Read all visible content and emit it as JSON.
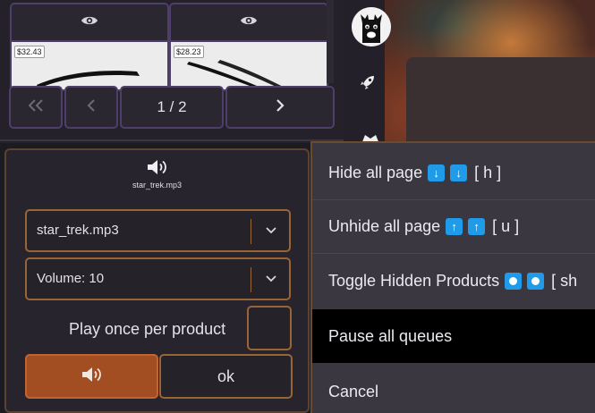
{
  "products": [
    {
      "price": "$32.43"
    },
    {
      "price": "$28.23"
    }
  ],
  "pager": {
    "page_label": "1 / 2"
  },
  "sound_modal": {
    "file_label": "star_trek.mp3",
    "sound_select_value": "star_trek.mp3",
    "volume_select_value": "Volume: 10",
    "play_once_label": "Play once per product",
    "ok_label": "ok"
  },
  "context_menu": {
    "items": [
      {
        "label": "Hide all page",
        "shortcut": "[ h ]"
      },
      {
        "label": "Unhide all page",
        "shortcut": "[ u ]"
      },
      {
        "label": "Toggle Hidden Products",
        "shortcut": "[ sh"
      },
      {
        "label": "Pause all queues"
      },
      {
        "label": "Cancel"
      }
    ]
  },
  "colors": {
    "accent_orange": "#a24d22",
    "badge_blue": "#1f9bea",
    "panel_border": "#4d3f6a"
  }
}
